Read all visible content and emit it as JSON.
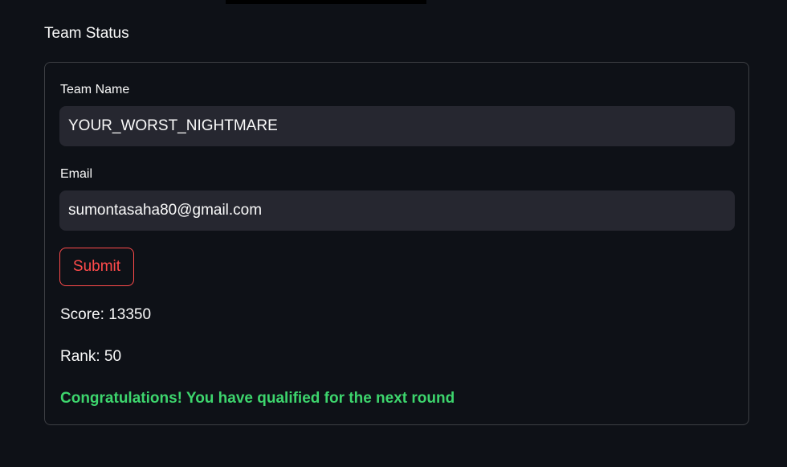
{
  "section": {
    "title": "Team Status"
  },
  "form": {
    "team_name_label": "Team Name",
    "team_name_value": "YOUR_WORST_NIGHTMARE",
    "email_label": "Email",
    "email_value": "sumontasaha80@gmail.com",
    "submit_label": "Submit"
  },
  "result": {
    "score_text": "Score: 13350",
    "rank_text": "Rank: 50",
    "message": "Congratulations! You have qualified for the next round"
  },
  "colors": {
    "background": "#0e1117",
    "input_background": "#262730",
    "accent": "#ff4b4b",
    "success": "#3dd56d"
  }
}
